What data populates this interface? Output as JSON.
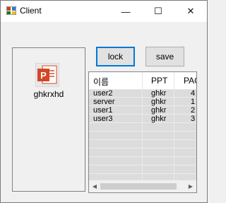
{
  "window": {
    "title": "Client",
    "minimize_glyph": "—",
    "maximize_glyph": "☐",
    "close_glyph": "✕"
  },
  "icons": {
    "app": "app-icon",
    "file": "powerpoint-file-icon"
  },
  "file_item": {
    "label": "ghkrxhd"
  },
  "buttons": {
    "lock": "lock",
    "save": "save"
  },
  "list": {
    "columns": [
      "이름",
      "PPT",
      "PAG"
    ],
    "rows": [
      [
        "user2",
        "ghkr",
        "4"
      ],
      [
        "server",
        "ghkr",
        "1"
      ],
      [
        "user1",
        "ghkr",
        "2"
      ],
      [
        "user3",
        "ghkr",
        "3"
      ]
    ]
  },
  "colors": {
    "accent": "#0078d7",
    "ppt_orange": "#d24726"
  }
}
